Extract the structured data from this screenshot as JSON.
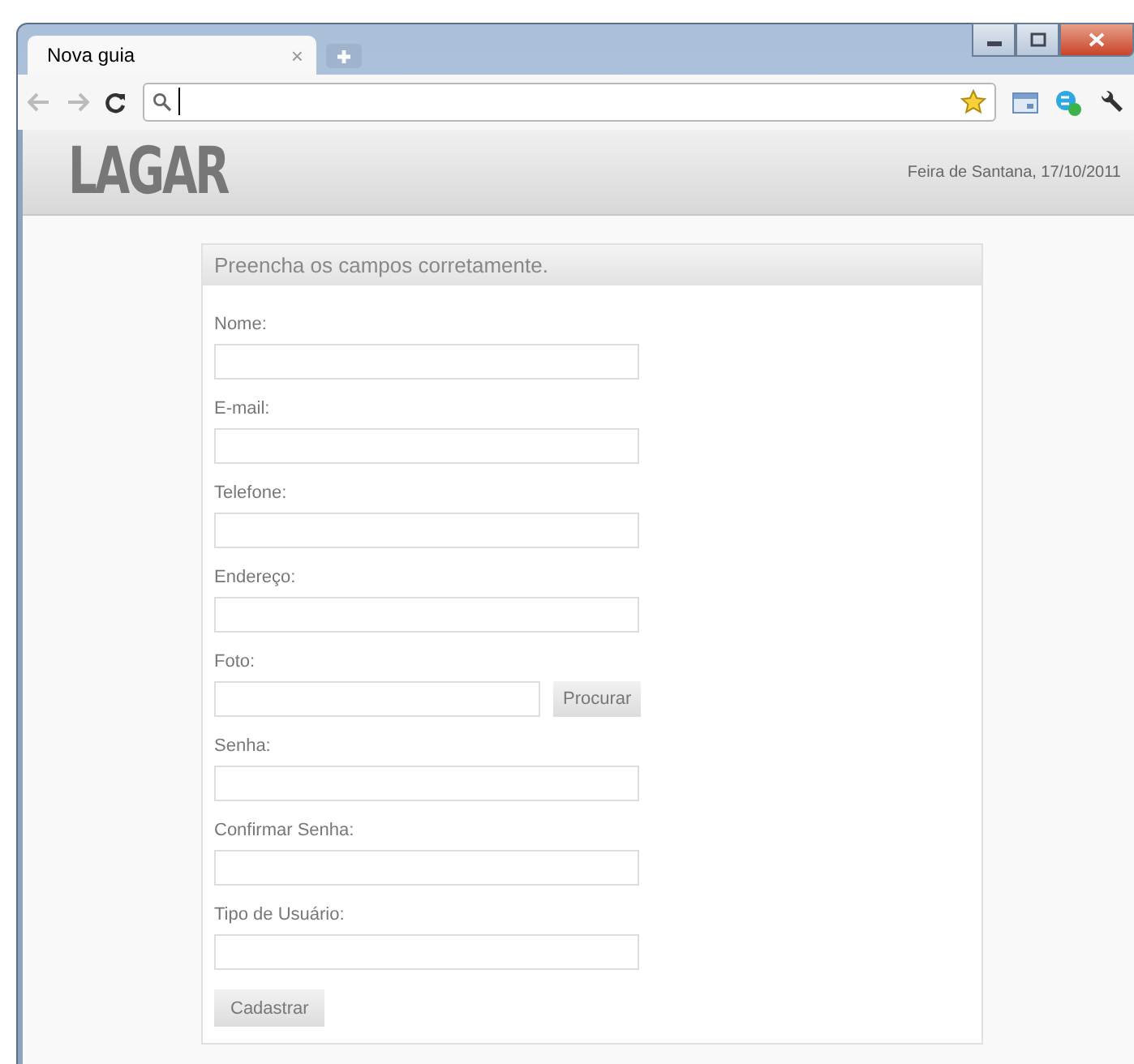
{
  "browser": {
    "tabs": [
      {
        "label": "Nova guia",
        "selected": true
      }
    ],
    "close_tab": "×"
  },
  "header": {
    "logo": "LAGAR",
    "location_date": "Feira de Santana, 17/10/2011"
  },
  "form": {
    "title": "Preencha os campos corretamente.",
    "fields": [
      {
        "label": "Nome:",
        "kind": "text"
      },
      {
        "label": "E-mail:",
        "kind": "text"
      },
      {
        "label": "Telefone:",
        "kind": "text"
      },
      {
        "label": "Endereço:",
        "kind": "text"
      },
      {
        "label": "Foto:",
        "kind": "file",
        "button": "Procurar"
      },
      {
        "label": "Senha:",
        "kind": "text"
      },
      {
        "label": "Confirmar Senha:",
        "kind": "text"
      },
      {
        "label": "Tipo de Usuário:",
        "kind": "text"
      }
    ],
    "submit": "Cadastrar"
  }
}
